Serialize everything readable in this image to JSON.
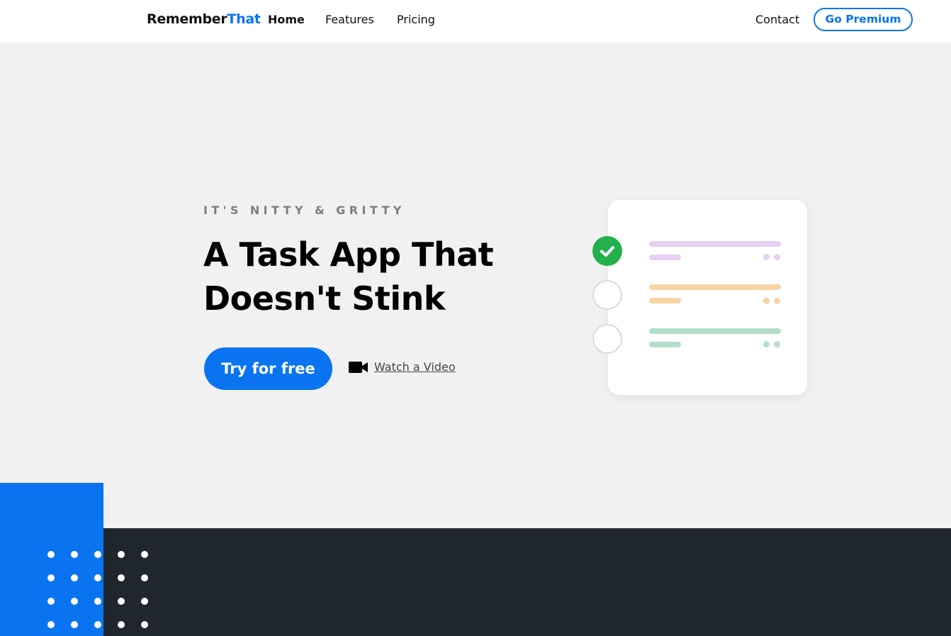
{
  "header": {
    "logo_part1": "Remember",
    "logo_part2": "That",
    "nav": {
      "home": "Home",
      "features": "Features",
      "pricing": "Pricing",
      "contact": "Contact"
    },
    "premium_label": "Go Premium"
  },
  "hero": {
    "eyebrow": "IT'S NITTY & GRITTY",
    "headline_line1": "A Task App That",
    "headline_line2": "Doesn't Stink",
    "cta_label": "Try for free",
    "video_label": "Watch a Video",
    "video_icon": "video-camera-icon"
  },
  "illustration": {
    "tasks": [
      {
        "status": "done",
        "color": "#e6d1f2"
      },
      {
        "status": "open",
        "color": "#f8d3a4"
      },
      {
        "status": "open",
        "color": "#b4dfcb"
      }
    ],
    "check_icon": "checkmark-icon"
  },
  "colors": {
    "accent": "#0a74f0",
    "success": "#22b04b",
    "dark_band": "#20262e",
    "background": "#f1f1f1"
  }
}
